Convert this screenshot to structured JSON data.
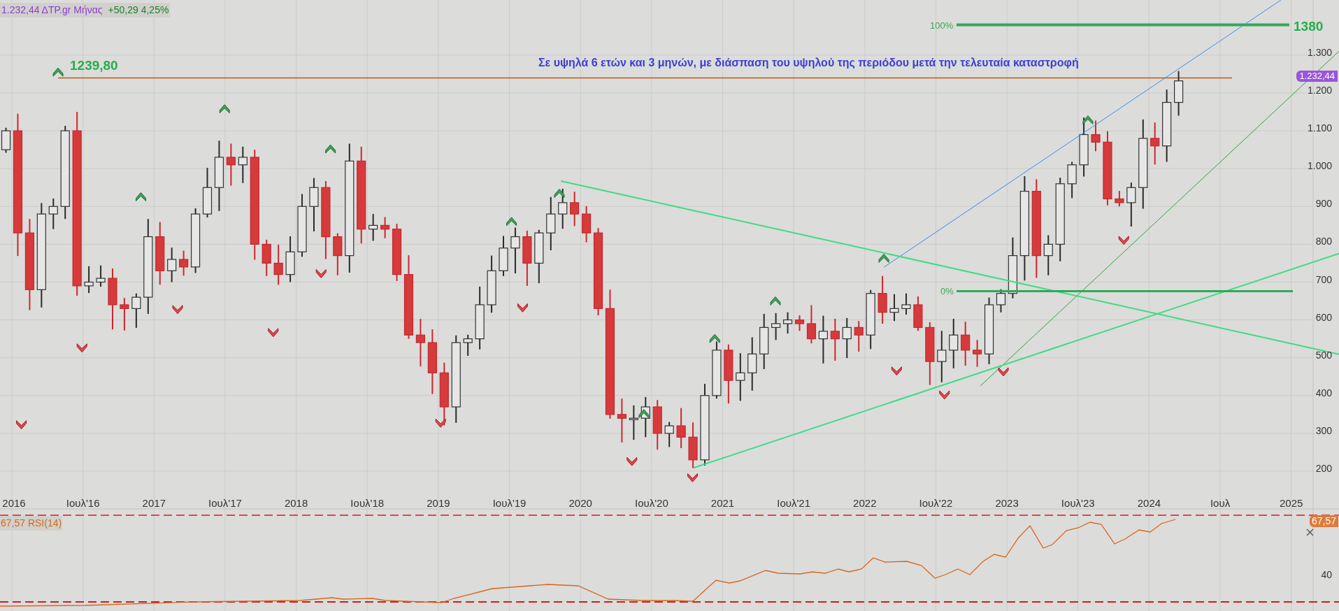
{
  "legend": {
    "label": "1.232,44 ΔTP.gr Μήνας",
    "change": "+50,29 4,25%"
  },
  "annotation": "Σε υψηλά 6 ετών και 3 μηνών, με διάσπαση του υψηλού της περιόδου μετά την τελευταία καταστροφή",
  "high_label": "1239,80",
  "fib_levels": [
    {
      "label": "100%",
      "value": "1380"
    },
    {
      "label": "0%"
    }
  ],
  "price_tag": "1.232,44",
  "y_ticks": [
    "1.300",
    "1.200",
    "1.100",
    "1.000",
    "900",
    "800",
    "700",
    "600",
    "500",
    "400",
    "300",
    "200"
  ],
  "x_ticks": [
    "2016",
    "Ιουλ'16",
    "2017",
    "Ιουλ'17",
    "2018",
    "Ιουλ'18",
    "2019",
    "Ιουλ'19",
    "2020",
    "Ιουλ'20",
    "2021",
    "Ιουλ'21",
    "2022",
    "Ιουλ'22",
    "2023",
    "Ιουλ'23",
    "2024",
    "Ιουλ",
    "2025"
  ],
  "rsi": {
    "label": "67,57 RSI(14)",
    "tag": "67,57",
    "y_ticks": [
      "40"
    ]
  }
}
